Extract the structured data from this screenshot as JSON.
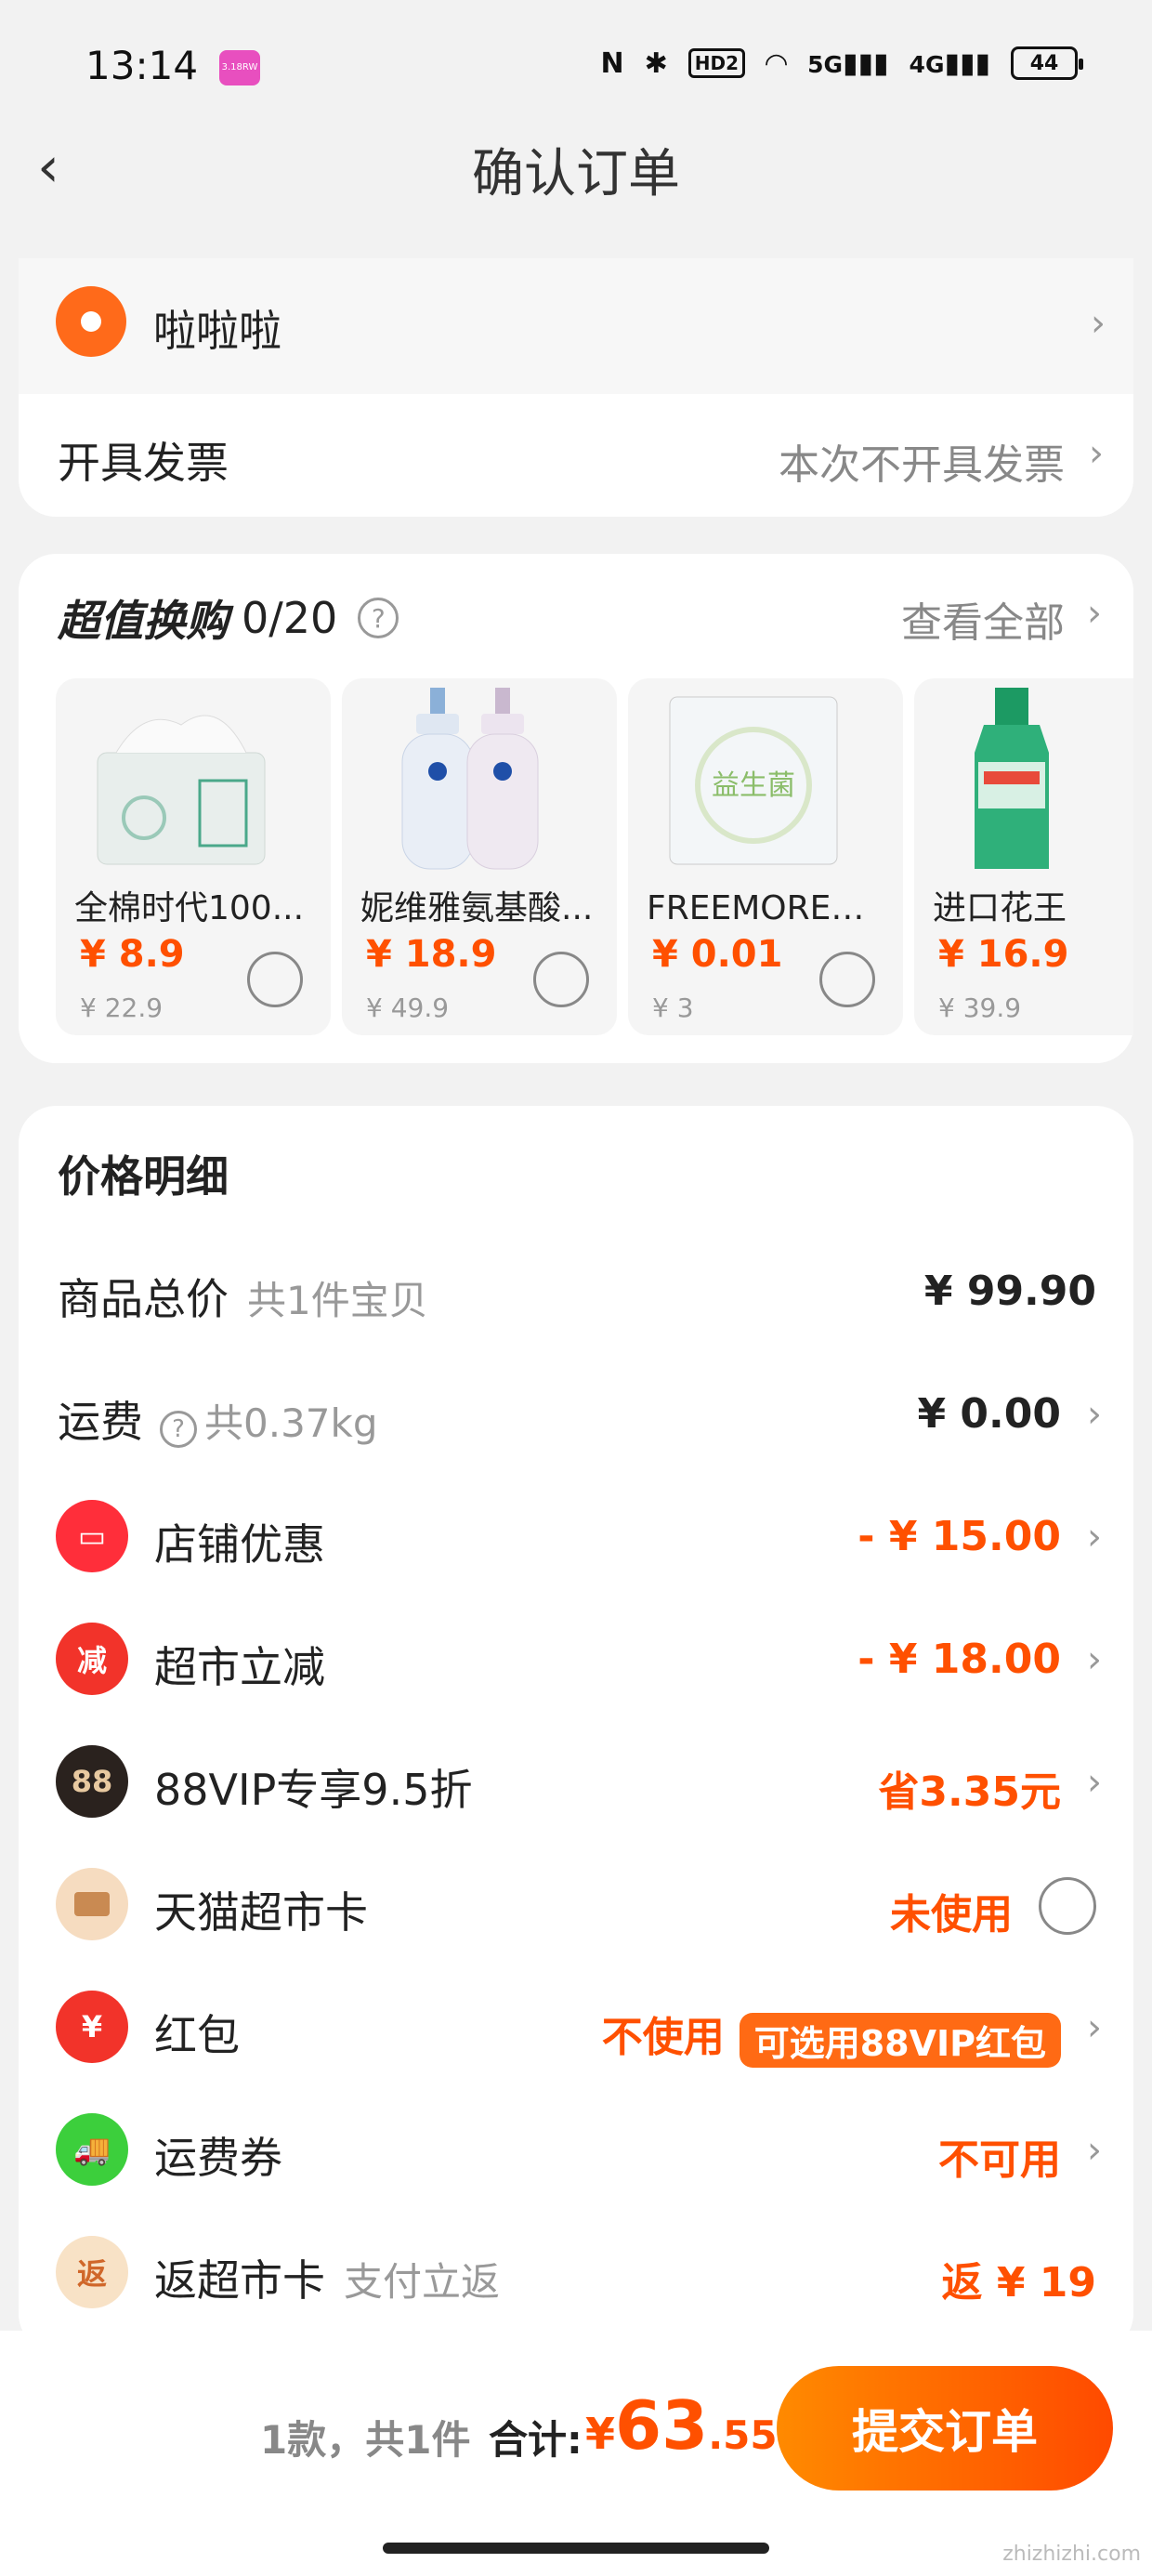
{
  "status": {
    "time": "13:14",
    "app_badge": "3.18RW",
    "icons": [
      "nfc-icon",
      "bluetooth-icon",
      "hd-icon",
      "wifi-icon",
      "signal-5g-icon",
      "signal-4g-icon"
    ],
    "hd": "HD2",
    "g5": "5G",
    "g4": "4G",
    "battery": "44"
  },
  "nav": {
    "title": "确认订单"
  },
  "address": {
    "name": "啦啦啦"
  },
  "invoice": {
    "label": "开具发票",
    "value": "本次不开具发票"
  },
  "swap": {
    "title": "超值换购",
    "count": "0/20",
    "view_all": "查看全部",
    "products": [
      {
        "name": "全棉时代100...",
        "price": "¥ 8.9",
        "orig": "¥ 22.9"
      },
      {
        "name": "妮维雅氨基酸...",
        "price": "¥ 18.9",
        "orig": "¥ 49.9"
      },
      {
        "name": "FREEMORE自...",
        "price": "¥ 0.01",
        "orig": "¥ 3",
        "img_text": "益生菌"
      },
      {
        "name": "进口花王",
        "price": "¥ 16.9",
        "orig": "¥ 39.9"
      }
    ]
  },
  "price": {
    "title": "价格明细",
    "rows": [
      {
        "label": "商品总价",
        "sub": "共1件宝贝",
        "value": "¥ 99.90"
      },
      {
        "label": "运费",
        "sub": "共0.37kg",
        "value": "¥ 0.00"
      },
      {
        "label": "店铺优惠",
        "value": "- ¥ 15.00"
      },
      {
        "label": "超市立减",
        "value": "- ¥ 18.00",
        "icon_text": "减"
      },
      {
        "label": "88VIP专享9.5折",
        "value": "省3.35元",
        "icon_text": "88"
      },
      {
        "label": "天猫超市卡",
        "value": "未使用"
      },
      {
        "label": "红包",
        "value": "不使用",
        "badge": "可选用88VIP红包",
        "icon_text": "¥"
      },
      {
        "label": "运费券",
        "value": "不可用"
      },
      {
        "label": "返超市卡",
        "sub": "支付立返",
        "value": "返 ¥ 19",
        "icon_text": "返"
      }
    ]
  },
  "bottom": {
    "count": "1款，共1件",
    "total_label": "合计:",
    "currency": "¥",
    "total_int": "63",
    "total_dec": ".55",
    "submit": "提交订单",
    "watermark": "zhizhizhi.com"
  },
  "colors": {
    "accent": "#ff5000",
    "bg": "#f2f2f2"
  }
}
